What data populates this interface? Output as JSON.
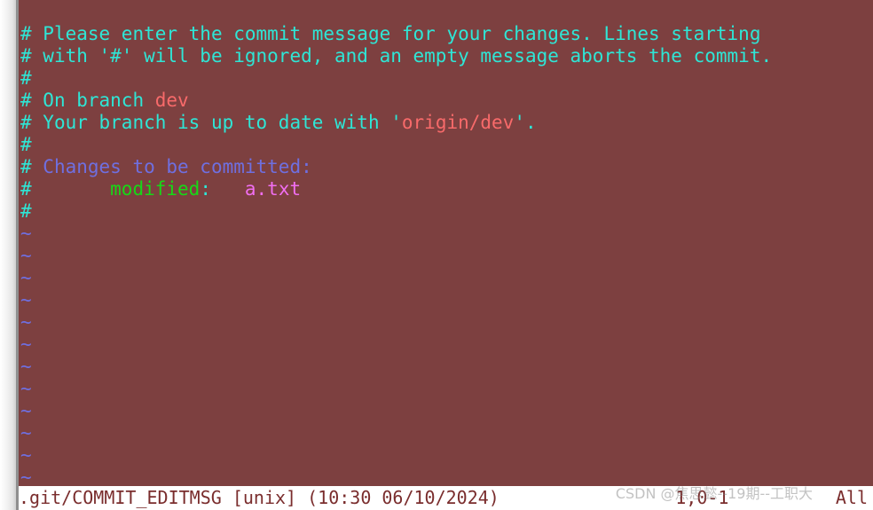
{
  "editor": {
    "background_color": "#7d4040",
    "lines": [
      {
        "segments": [
          {
            "text": "#",
            "color": "cyan"
          },
          {
            "text": " Please enter the commit message for your changes. Lines starting",
            "color": "cyan"
          }
        ]
      },
      {
        "segments": [
          {
            "text": "#",
            "color": "cyan"
          },
          {
            "text": " with '#' will be ignored, and an empty message aborts the commit.",
            "color": "cyan"
          }
        ]
      },
      {
        "segments": [
          {
            "text": "#",
            "color": "cyan"
          }
        ]
      },
      {
        "segments": [
          {
            "text": "#",
            "color": "cyan"
          },
          {
            "text": " On branch ",
            "color": "cyan"
          },
          {
            "text": "dev",
            "color": "salmon"
          }
        ]
      },
      {
        "segments": [
          {
            "text": "#",
            "color": "cyan"
          },
          {
            "text": " Your branch is up to date with '",
            "color": "cyan"
          },
          {
            "text": "origin/dev",
            "color": "salmon"
          },
          {
            "text": "'.",
            "color": "cyan"
          }
        ]
      },
      {
        "segments": [
          {
            "text": "#",
            "color": "cyan"
          }
        ]
      },
      {
        "segments": [
          {
            "text": "#",
            "color": "cyan"
          },
          {
            "text": " Changes to be committed:",
            "color": "blue"
          }
        ]
      },
      {
        "segments": [
          {
            "text": "#",
            "color": "cyan"
          },
          {
            "text": "       modified",
            "color": "green"
          },
          {
            "text": ":",
            "color": "cyan"
          },
          {
            "text": "   a.txt",
            "color": "magenta"
          }
        ]
      },
      {
        "segments": [
          {
            "text": "#",
            "color": "cyan"
          }
        ]
      }
    ],
    "empty_line_marker": "~",
    "empty_line_count": 13
  },
  "statusbar": {
    "file_info": ".git/COMMIT_EDITMSG [unix] (10:30 06/10/2024)",
    "cursor_position": "1,0-1",
    "scroll_position": "All",
    "right_text": "1,0-1          All"
  },
  "watermark": {
    "text": "CSDN @焦思懿--19期--工职大"
  }
}
